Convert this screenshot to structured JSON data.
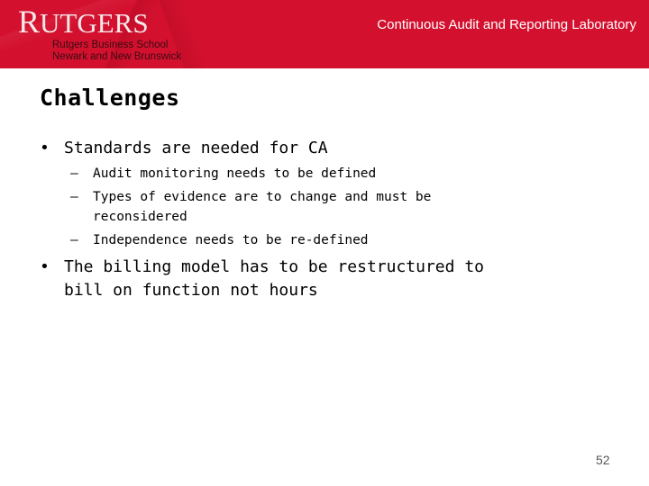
{
  "header": {
    "logo_text": "RUTGERS",
    "logo_first_letter": "R",
    "logo_rest": "UTGERS",
    "school_line1": "Rutgers Business School",
    "school_line2": "Newark and New Brunswick",
    "lab_title": "Continuous Audit and Reporting Laboratory",
    "brand_color": "#d3112f"
  },
  "slide": {
    "title": "Challenges",
    "bullets": [
      {
        "marker": "•",
        "text_lines": [
          "Standards are needed for CA"
        ],
        "sub_bullets": [
          {
            "marker": "–",
            "text_lines": [
              "Audit monitoring needs to be defined"
            ]
          },
          {
            "marker": "–",
            "text_lines": [
              "Types of evidence are to change and must be",
              "reconsidered"
            ]
          },
          {
            "marker": "–",
            "text_lines": [
              "Independence needs to be re-defined"
            ]
          }
        ]
      },
      {
        "marker": "•",
        "text_lines": [
          "The billing model has to be restructured to",
          "bill on function not hours"
        ],
        "sub_bullets": []
      }
    ],
    "page_number": "52"
  }
}
